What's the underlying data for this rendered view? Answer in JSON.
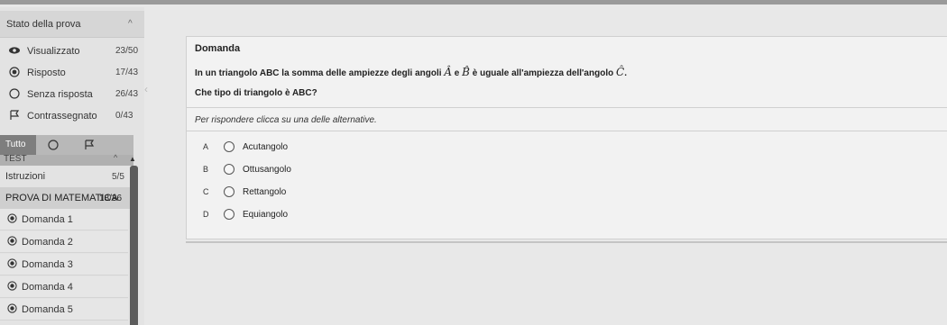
{
  "sidebar": {
    "status_title": "Stato della prova",
    "stats": [
      {
        "label": "Visualizzato",
        "count": "23/50",
        "icon": "eye-icon"
      },
      {
        "label": "Risposto",
        "count": "17/43",
        "icon": "radio-filled-icon"
      },
      {
        "label": "Senza risposta",
        "count": "26/43",
        "icon": "radio-empty-icon"
      },
      {
        "label": "Contrassegnato",
        "count": "0/43",
        "icon": "flag-icon"
      }
    ],
    "filter": {
      "all_label": "Tutto"
    },
    "test_label": "TEST",
    "sections": [
      {
        "label": "Istruzioni",
        "count": "5/5"
      },
      {
        "label": "PROVA DI MATEMATICA",
        "count": "18/36"
      }
    ],
    "questions": [
      {
        "label": "Domanda 1"
      },
      {
        "label": "Domanda 2"
      },
      {
        "label": "Domanda 3"
      },
      {
        "label": "Domanda 4"
      },
      {
        "label": "Domanda 5"
      }
    ]
  },
  "main": {
    "title": "Domanda",
    "text_before": "In un triangolo ABC la somma delle ampiezze degli angoli",
    "angle_a": "Â",
    "conj": "e",
    "angle_b": "B̂",
    "text_mid": "è uguale all'ampiezza dell'angolo",
    "angle_c": "Ĉ",
    "text_end": ".",
    "sub_question": "Che tipo di triangolo è ABC?",
    "instructions": "Per rispondere clicca su una delle alternative.",
    "options": [
      {
        "letter": "A",
        "text": "Acutangolo"
      },
      {
        "letter": "B",
        "text": "Ottusangolo"
      },
      {
        "letter": "C",
        "text": "Rettangolo"
      },
      {
        "letter": "D",
        "text": "Equiangolo"
      }
    ]
  }
}
